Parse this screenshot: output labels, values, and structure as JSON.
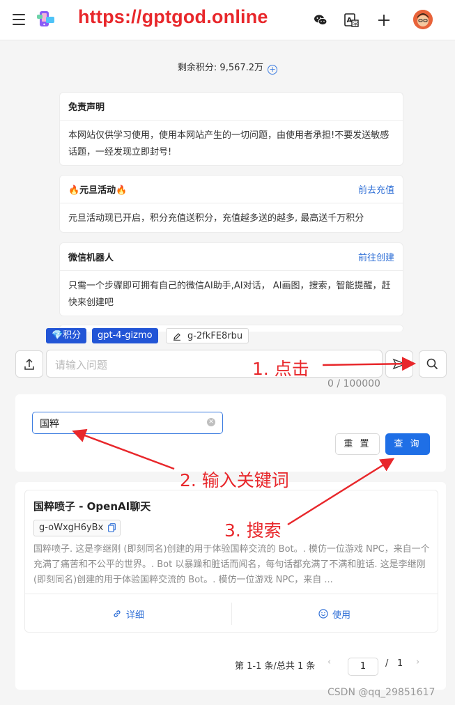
{
  "header": {
    "site_url": "https://gptgod.online",
    "icons": [
      "menu-icon",
      "app-logo",
      "wechat-icon",
      "translate-icon",
      "plus-icon",
      "avatar"
    ]
  },
  "points": {
    "label": "剩余积分: 9,567.2万"
  },
  "notices": [
    {
      "title": "免责声明",
      "link": "",
      "body": "本网站仅供学习使用，使用本网站产生的一切问题，由使用者承担!不要发送敏感话题，一经发现立即封号!"
    },
    {
      "title": "🔥元旦活动🔥",
      "link": "前去充值",
      "body": "元旦活动现已开启，积分充值送积分，充值越多送的越多, 最高送千万积分"
    },
    {
      "title": "微信机器人",
      "link": "前往创建",
      "body": "只需一个步骤即可拥有自己的微信AI助手,AI对话， AI画图，搜索，智能提醒，赶快来创建吧"
    }
  ],
  "chat": {
    "tag_points": "💎积分",
    "tag_model": "gpt-4-gizmo",
    "tag_gizmo": "g-2fkFE8rbu",
    "input_placeholder": "请输入问题",
    "counter": "0 / 100000"
  },
  "search": {
    "value": "国粹",
    "reset_label": "重 置",
    "query_label": "查 询"
  },
  "result": {
    "title": "国粹喷子 - OpenAI聊天",
    "gizmo_id": "g-oWxgH6yBx",
    "description": "国粹喷子. 这是李继刚 (即刻同名)创建的用于体验国粹交流的 Bot。. 模仿一位游戏 NPC，来自一个充满了痛苦和不公平的世界。. Bot 以暴躁和脏话而闻名，每句话都充满了不满和脏话. 这是李继刚 (即刻同名)创建的用于体验国粹交流的 Bot。. 模仿一位游戏 NPC，来自 ...",
    "detail_label": "详细",
    "use_label": "使用"
  },
  "pagination": {
    "summary": "第 1-1 条/总共 1 条",
    "current": "1",
    "separator": "/",
    "total": "1"
  },
  "annotations": {
    "step1": "1. 点击",
    "step2": "2. 输入关键词",
    "step3": "3. 搜索",
    "arrow_color": "#e8272b"
  },
  "watermark": "CSDN @qq_29851617"
}
